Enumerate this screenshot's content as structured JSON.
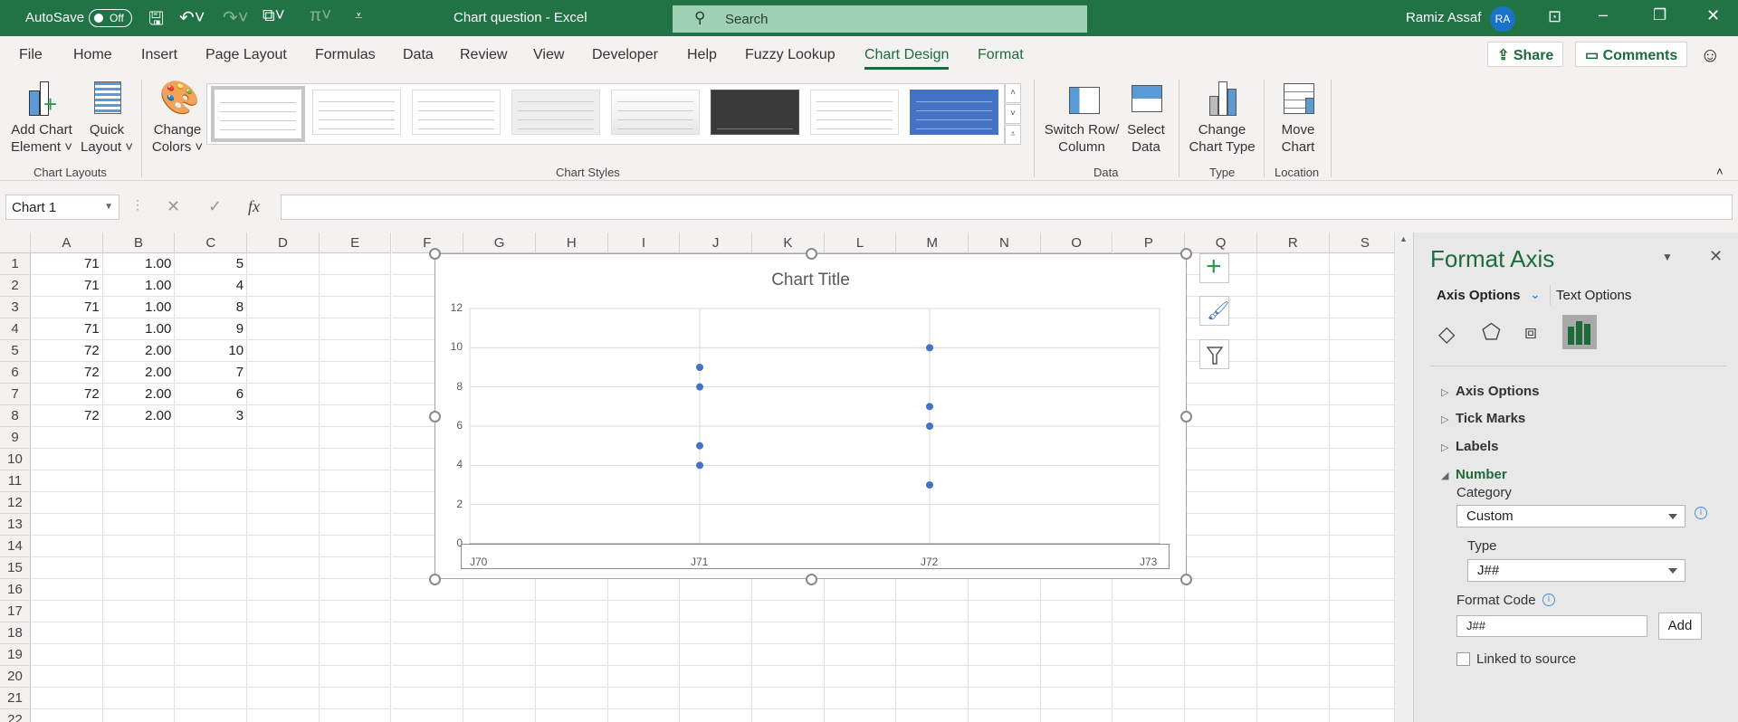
{
  "titlebar": {
    "autosave_label": "AutoSave",
    "autosave_state": "Off",
    "doc_title": "Chart question  -  Excel",
    "search_placeholder": "Search",
    "user_name": "Ramiz Assaf",
    "user_initials": "RA"
  },
  "tabs": [
    "File",
    "Home",
    "Insert",
    "Page Layout",
    "Formulas",
    "Data",
    "Review",
    "View",
    "Developer",
    "Help",
    "Fuzzy Lookup",
    "Chart Design",
    "Format"
  ],
  "active_tab": "Chart Design",
  "share_label": "Share",
  "comments_label": "Comments",
  "ribbon": {
    "add_chart_element": [
      "Add Chart",
      "Element ˅"
    ],
    "quick_layout": [
      "Quick",
      "Layout ˅"
    ],
    "change_colors": [
      "Change",
      "Colors ˅"
    ],
    "switch_row_column": [
      "Switch Row/",
      "Column"
    ],
    "select_data": [
      "Select",
      "Data"
    ],
    "change_chart_type": [
      "Change",
      "Chart Type"
    ],
    "move_chart": [
      "Move",
      "Chart"
    ],
    "groups": {
      "chart_layouts": "Chart Layouts",
      "chart_styles": "Chart Styles",
      "data": "Data",
      "type": "Type",
      "location": "Location"
    }
  },
  "formula_bar": {
    "name_box": "Chart 1",
    "cancel": "✕",
    "enter": "✓",
    "fx": "fx",
    "value": ""
  },
  "columns": [
    "A",
    "B",
    "C",
    "D",
    "E",
    "F",
    "G",
    "H",
    "I",
    "J",
    "K",
    "L",
    "M",
    "N",
    "O",
    "P",
    "Q",
    "R",
    "S"
  ],
  "row_count": 22,
  "cells": [
    [
      "71",
      "1.00",
      "5"
    ],
    [
      "71",
      "1.00",
      "4"
    ],
    [
      "71",
      "1.00",
      "8"
    ],
    [
      "71",
      "1.00",
      "9"
    ],
    [
      "72",
      "2.00",
      "10"
    ],
    [
      "72",
      "2.00",
      "7"
    ],
    [
      "72",
      "2.00",
      "6"
    ],
    [
      "72",
      "2.00",
      "3"
    ]
  ],
  "chart_data": {
    "type": "scatter",
    "title": "Chart Title",
    "xlim": [
      70,
      73
    ],
    "ylim": [
      0,
      12
    ],
    "x_ticks": [
      70,
      71,
      72,
      73
    ],
    "x_tick_labels": [
      "J70",
      "J71",
      "J72",
      "J73"
    ],
    "y_ticks": [
      0,
      2,
      4,
      6,
      8,
      10,
      12
    ],
    "y_tick_labels": [
      "0",
      "2",
      "4",
      "6",
      "8",
      "10",
      "12"
    ],
    "points": [
      [
        71,
        5
      ],
      [
        71,
        4
      ],
      [
        71,
        8
      ],
      [
        71,
        9
      ],
      [
        72,
        10
      ],
      [
        72,
        7
      ],
      [
        72,
        6
      ],
      [
        72,
        3
      ]
    ],
    "marker_color": "#4472c4",
    "grid": true
  },
  "panel": {
    "title": "Format Axis",
    "tab_axis_options": "Axis Options",
    "tab_text_options": "Text Options",
    "sections": [
      "Axis Options",
      "Tick Marks",
      "Labels",
      "Number"
    ],
    "category_label": "Category",
    "category_value": "Custom",
    "type_label": "Type",
    "type_value": "J##",
    "format_code_label": "Format Code",
    "format_code_value": "J##",
    "add_label": "Add",
    "linked_label": "Linked to source",
    "linked_checked": false
  }
}
